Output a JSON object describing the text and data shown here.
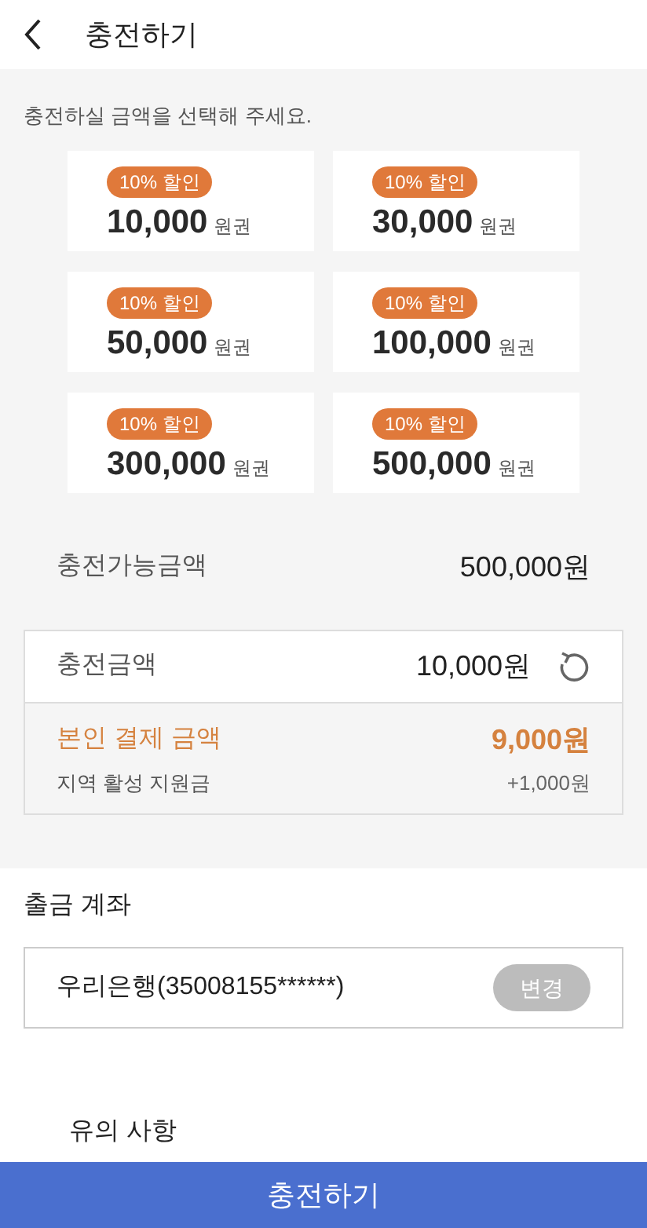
{
  "header": {
    "title": "충전하기"
  },
  "instruction": "충전하실 금액을 선택해 주세요.",
  "vouchers": [
    {
      "discount": "10% 할인",
      "amount": "10,000",
      "unit": "원권"
    },
    {
      "discount": "10% 할인",
      "amount": "30,000",
      "unit": "원권"
    },
    {
      "discount": "10% 할인",
      "amount": "50,000",
      "unit": "원권"
    },
    {
      "discount": "10% 할인",
      "amount": "100,000",
      "unit": "원권"
    },
    {
      "discount": "10% 할인",
      "amount": "300,000",
      "unit": "원권"
    },
    {
      "discount": "10% 할인",
      "amount": "500,000",
      "unit": "원권"
    }
  ],
  "available": {
    "label": "충전가능금액",
    "value": "500,000원"
  },
  "summary": {
    "charge_label": "충전금액",
    "charge_value": "10,000원",
    "pay_label": "본인 결제 금액",
    "pay_value": "9,000원",
    "support_label": "지역 활성 지원금",
    "support_value": "+1,000원"
  },
  "account": {
    "heading": "출금 계좌",
    "value": "우리은행(35008155******)",
    "change_button": "변경"
  },
  "notice": {
    "heading": "유의 사항"
  },
  "submit_button": "충전하기"
}
